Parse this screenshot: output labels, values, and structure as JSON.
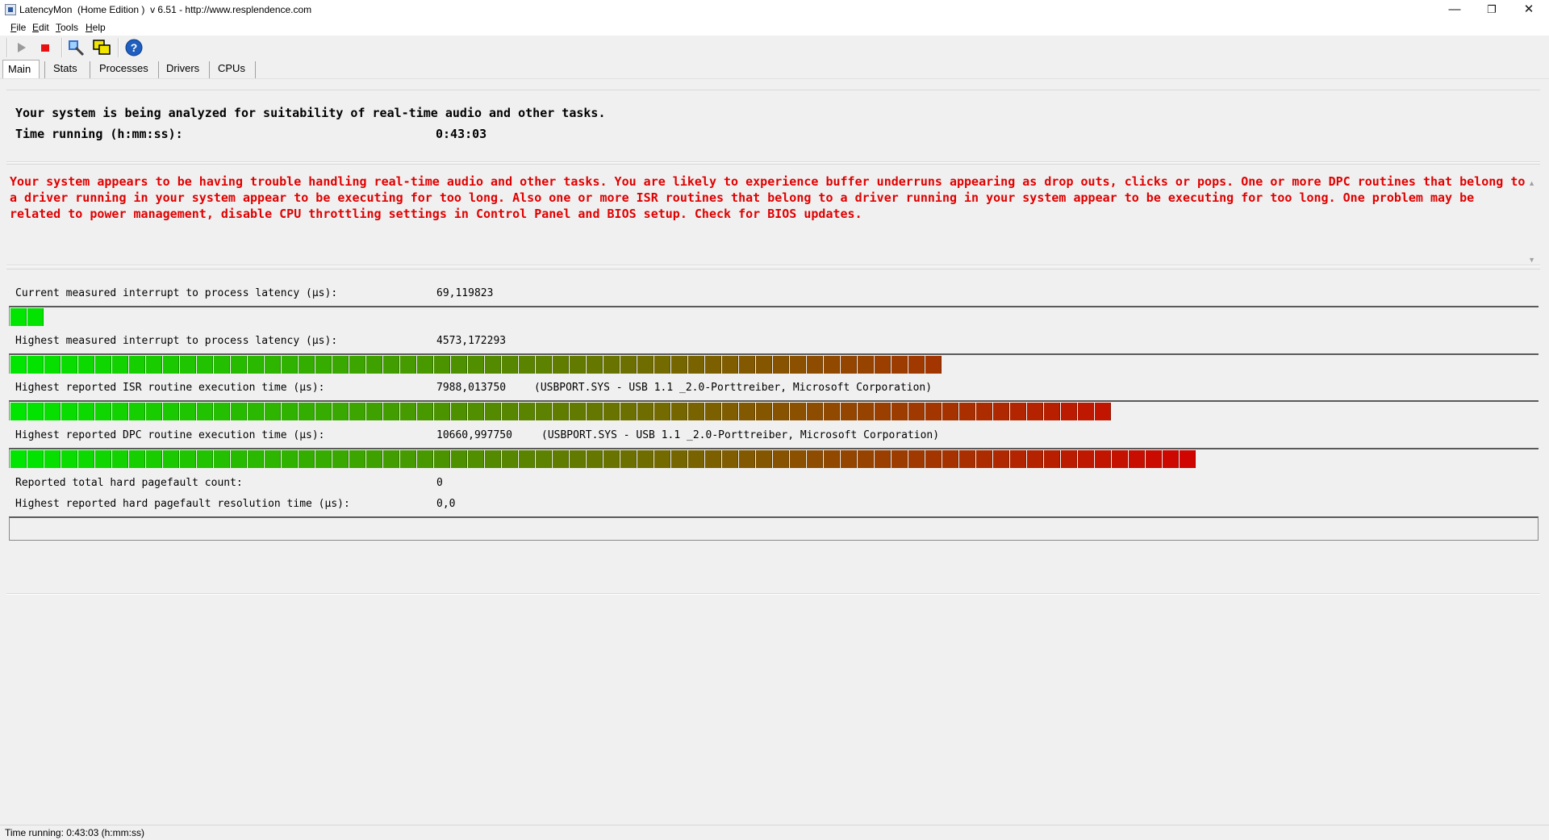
{
  "window": {
    "title": "LatencyMon  (Home Edition )  v 6.51 - http://www.resplendence.com",
    "minimize": "—",
    "maximize": "❐",
    "close": "✕"
  },
  "menu": [
    "File",
    "Edit",
    "Tools",
    "Help"
  ],
  "toolbar": {
    "start_icon": "play-icon",
    "stop_icon": "stop-icon",
    "tools_icon": "analyze-icon",
    "windows_icon": "windows-icon",
    "help_icon": "help-icon",
    "help_glyph": "?"
  },
  "tabs": [
    "Main",
    "Stats",
    "Processes",
    "Drivers",
    "CPUs"
  ],
  "analysis": {
    "line1": "Your system is being analyzed for suitability of real-time audio and other tasks.",
    "time_label": "Time running (h:mm:ss):",
    "time_value": "0:43:03"
  },
  "warning": {
    "text": "Your system appears to be having trouble handling real-time audio and other tasks. You are likely to experience buffer underruns appearing as drop outs, clicks or pops. One or more DPC routines that belong to a driver running in your system appear to be executing for too long. Also one or more ISR routines that belong to a driver running in your system appear to be executing for too long. One problem may be related to power management, disable CPU throttling settings in Control Panel and BIOS setup. Check for BIOS updates.",
    "color": "#e00000",
    "scroll_up": "▲",
    "scroll_down": "▼"
  },
  "metrics": {
    "current": {
      "label": "Current measured interrupt to process latency (µs):",
      "value": "69,119823",
      "bar_fraction": 0.022
    },
    "highest": {
      "label": "Highest measured interrupt to process latency (µs):",
      "value": "4573,172293",
      "bar_fraction": 0.612
    },
    "isr": {
      "label": "Highest reported ISR routine execution time (µs):",
      "value": "7988,013750",
      "detail": "(USBPORT.SYS - USB 1.1 _2.0-Porttreiber, Microsoft Corporation)",
      "bar_fraction": 0.723
    },
    "dpc": {
      "label": "Highest reported DPC routine execution time (µs):",
      "value": "10660,997750",
      "detail": "(USBPORT.SYS - USB 1.1 _2.0-Porttreiber, Microsoft Corporation)",
      "bar_fraction": 0.781
    },
    "pagefault_count": {
      "label": "Reported total hard pagefault count:",
      "value": "0"
    },
    "pagefault_time": {
      "label": "Highest reported hard pagefault resolution time (µs):",
      "value": "0,0",
      "bar_fraction": 0
    }
  },
  "colors": {
    "bar_start": "#00e600",
    "bar_end": "#d40000"
  },
  "status": {
    "text": "Time running: 0:43:03  (h:mm:ss)"
  }
}
